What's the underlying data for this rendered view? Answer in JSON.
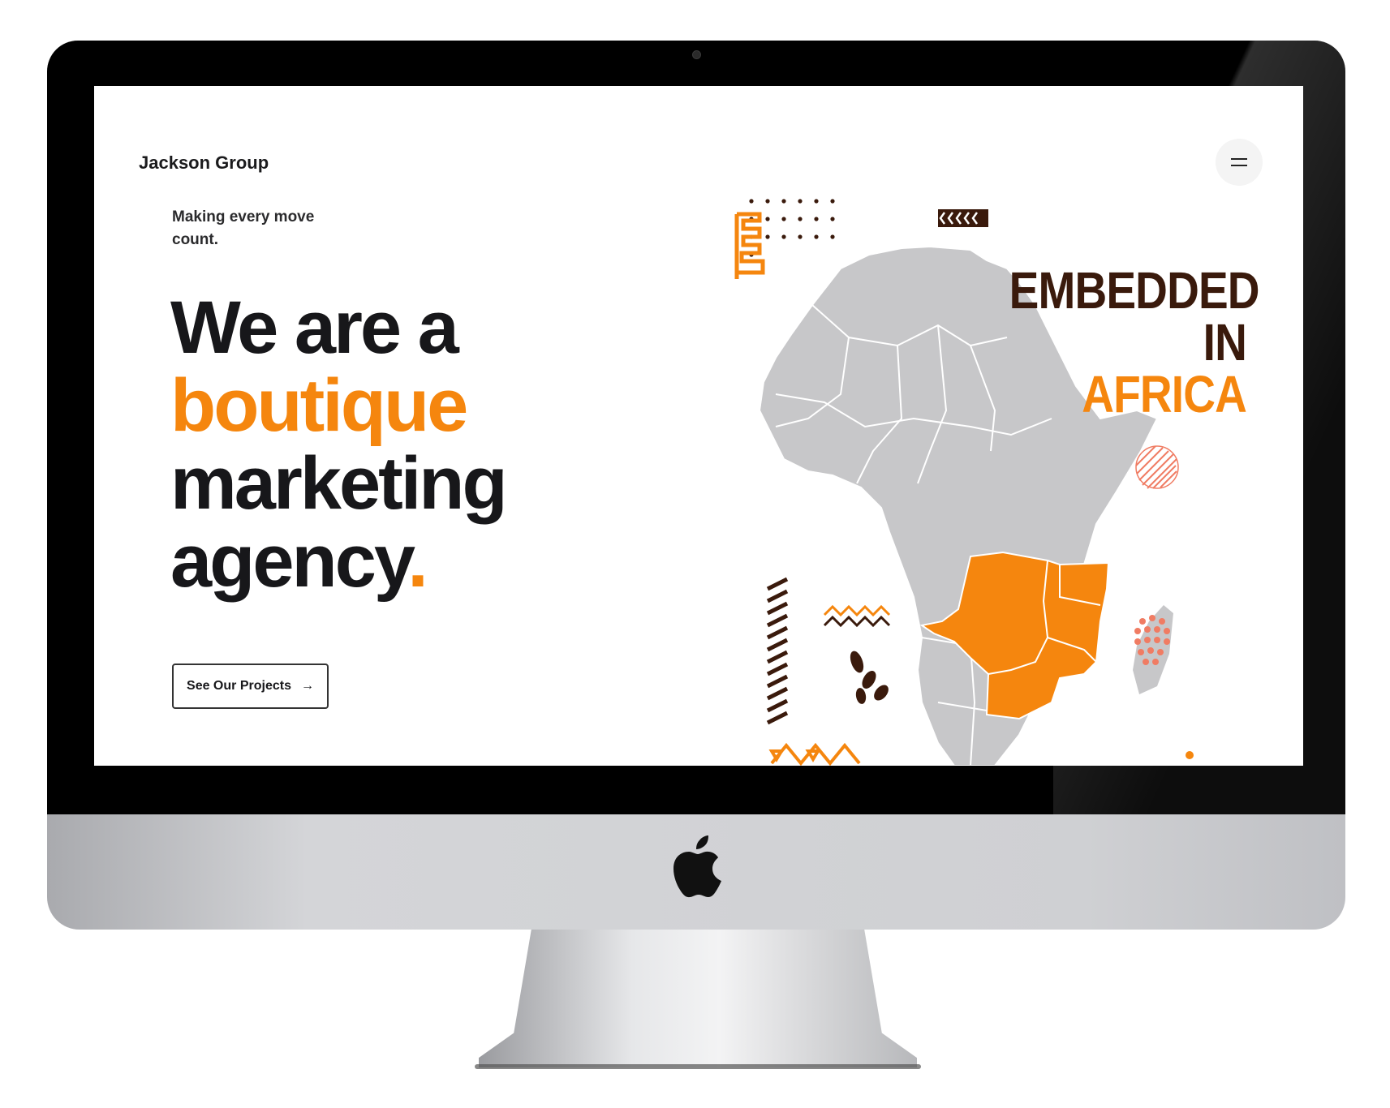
{
  "site": {
    "brand": "Jackson Group",
    "tagline": "Making every move count.",
    "headline": {
      "line1": "We are a",
      "line2": "boutique",
      "line3": "marketing",
      "line4": "agency",
      "period": "."
    },
    "cta_label": "See Our Projects",
    "cta_arrow": "→",
    "artwork": {
      "title_line1": "EMBEDDED",
      "title_in": "IN",
      "title_africa": "AFRICA"
    },
    "menu_icon": "hamburger-icon"
  },
  "colors": {
    "accent": "#f5860e",
    "text": "#17171a",
    "brown": "#3a1a0c",
    "map_gray": "#c7c7c9"
  }
}
